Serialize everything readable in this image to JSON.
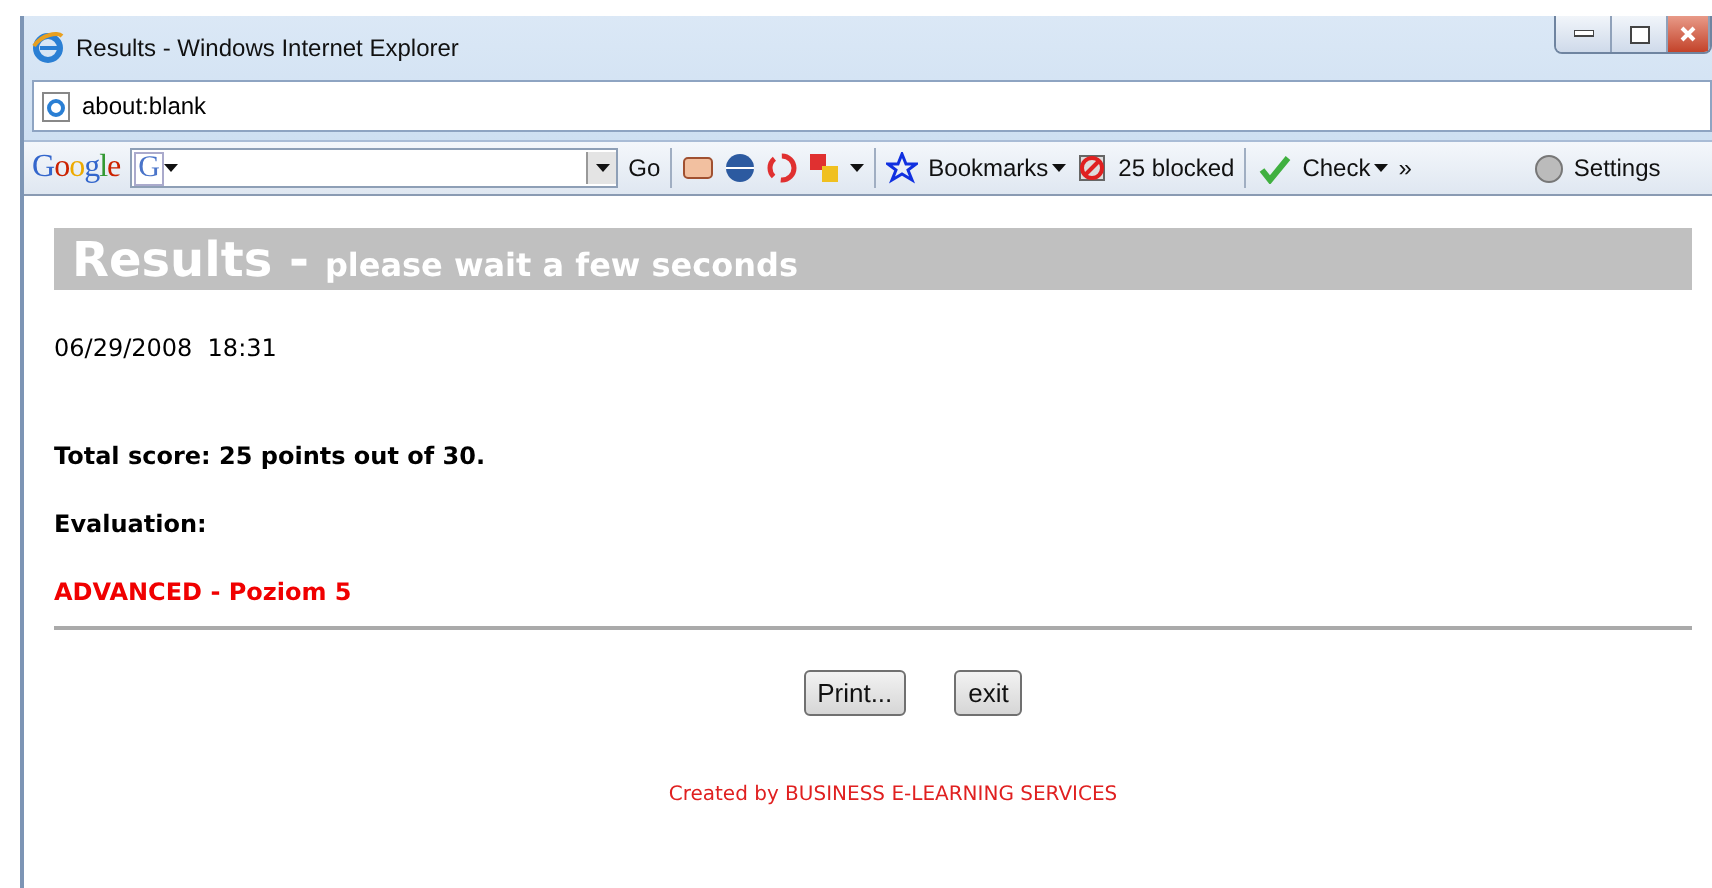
{
  "window": {
    "title": "Results - Windows Internet Explorer"
  },
  "address_bar": {
    "value": "about:blank"
  },
  "toolbar": {
    "logo": "Google",
    "search_letter": "G",
    "go": "Go",
    "bookmarks": "Bookmarks",
    "blocked": "25 blocked",
    "check": "Check",
    "more": "»",
    "settings": "Settings"
  },
  "page": {
    "heading": "Results -",
    "subheading": "please wait a few seconds",
    "datetime": "06/29/2008  18:31",
    "score": "Total score: 25 points out of 30.",
    "evaluation_label": "Evaluation:",
    "evaluation": "ADVANCED - Poziom 5",
    "buttons": [
      "Print...",
      "exit"
    ],
    "footer": "Created by BUSINESS E-LEARNING SERVICES"
  }
}
